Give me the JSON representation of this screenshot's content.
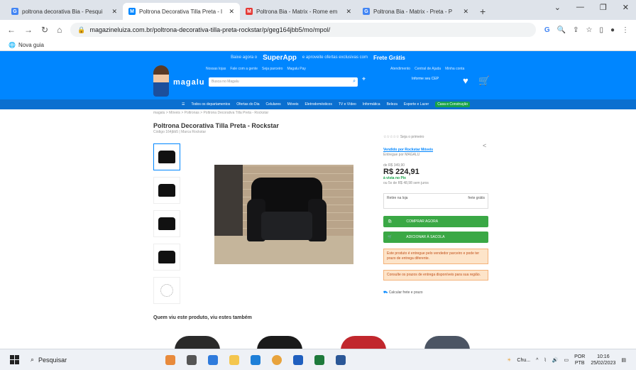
{
  "browser": {
    "tabs": [
      {
        "title": "poltrona decorativa Bia - Pesqui",
        "favicon": "G",
        "favicon_color": "#4285f4",
        "active": false
      },
      {
        "title": "Poltrona Decorativa Tilla Preta - l",
        "favicon": "M",
        "favicon_color": "#0086ff",
        "active": true
      },
      {
        "title": "Poltrona Bia - Matrix - Rome em",
        "favicon": "M",
        "favicon_color": "#e53935",
        "active": false
      },
      {
        "title": "Poltrona Bia - Matrix - Preta - P",
        "favicon": "G",
        "favicon_color": "#4285f4",
        "active": false
      }
    ],
    "url": "magazineluiza.com.br/poltrona-decorativa-tilla-preta-rockstar/p/geg164jbb5/mo/mpol/",
    "bookmark": "Nova guia"
  },
  "header": {
    "promo_text": "Baixe agora o",
    "app_name": "SuperApp",
    "promo_text2": "e aproveite ofertas exclusivas com",
    "frete": "Frete Grátis",
    "links_left": [
      "Nossas lojas",
      "Fale com a gente",
      "Seja parceiro",
      "Magalu Pay"
    ],
    "links_right": [
      "Atendimento",
      "Central de Ajuda",
      "Minha conta"
    ],
    "logo": "magalu",
    "search_placeholder": "Busca no Magalu",
    "cep_label": "Informe seu CEP",
    "categories": [
      "Todos os departamentos",
      "Ofertas do Dia",
      "Celulares",
      "Móveis",
      "Eletrodomésticos",
      "TV e Vídeo",
      "Informática",
      "Beleza",
      "Esporte e Lazer",
      "Casa e Construção"
    ]
  },
  "product": {
    "breadcrumb": "magalu > Móveis > Poltronas > Poltrona Decorativa Tilla Preta - Rockstar",
    "title": "Poltrona Decorativa Tilla Preta - Rockstar",
    "subtitle": "Código 164jbb5 | Marca Rockstar",
    "rating_text": "Seja o primeiro",
    "seller_line": "Vendido por Rockstar Móveis",
    "delivery_line": "Entregue por MAGALU",
    "old_price_label": "de R$ 349,90",
    "price": "R$ 224,91",
    "pix": "à vista no Pix",
    "installments": "ou 5x de R$ 48,98 sem juros",
    "shipping_label": "Retire na loja",
    "shipping_value": "frete grátis",
    "buy_button": "COMPRAR AGORA",
    "cart_button": "ADICIONAR À SACOLA",
    "warning_1": "Este produto é entregue pelo vendedor parceiro e pode ter prazo de entrega diferente.",
    "warning_2": "Consulte os prazos de entrega disponíveis para sua região.",
    "calc": "Calcular frete e prazo",
    "seen_title": "Quem viu este produto, viu estes também"
  },
  "taskbar": {
    "search": "Pesquisar",
    "chrome_label": "Chu...",
    "lang": "POR",
    "lang2": "PTB",
    "time": "10:16",
    "date": "25/02/2023"
  }
}
